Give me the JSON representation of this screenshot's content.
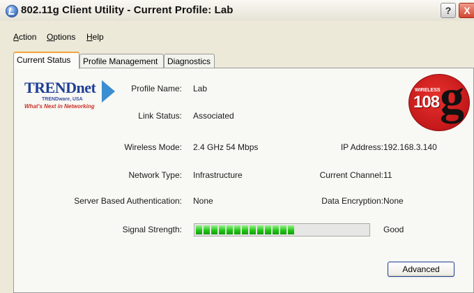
{
  "window": {
    "title": "802.11g Client Utility - Current Profile: Lab",
    "help_label": "?",
    "close_label": "X"
  },
  "menu": [
    "Action",
    "Options",
    "Help"
  ],
  "tabs": [
    {
      "label": "Current Status",
      "active": true
    },
    {
      "label": "Profile Management",
      "active": false
    },
    {
      "label": "Diagnostics",
      "active": false
    }
  ],
  "logo": {
    "name": "TRENDnet",
    "sub": "TRENDware, USA",
    "tagline": "What's Next in Networking"
  },
  "badge": {
    "word": "WIRELESS",
    "speed": "108",
    "letter": "g"
  },
  "status": {
    "profile_name_label": "Profile Name:",
    "profile_name": "Lab",
    "link_status_label": "Link Status:",
    "link_status": "Associated",
    "wireless_mode_label": "Wireless Mode:",
    "wireless_mode": "2.4 GHz 54 Mbps",
    "ip_address_label": "IP Address:",
    "ip_address": "192.168.3.140",
    "network_type_label": "Network Type:",
    "network_type": "Infrastructure",
    "current_channel_label": "Current Channel:",
    "current_channel": "11",
    "server_auth_label": "Server Based Authentication:",
    "server_auth": "None",
    "data_encryption_label": "Data Encryption:",
    "data_encryption": "None",
    "signal_strength_label": "Signal Strength:",
    "signal_strength": "Good",
    "signal_level_percent": 59
  },
  "buttons": {
    "advanced": "Advanced"
  },
  "colors": {
    "signal": "#22c816",
    "accent_tab": "#f2a53a"
  }
}
